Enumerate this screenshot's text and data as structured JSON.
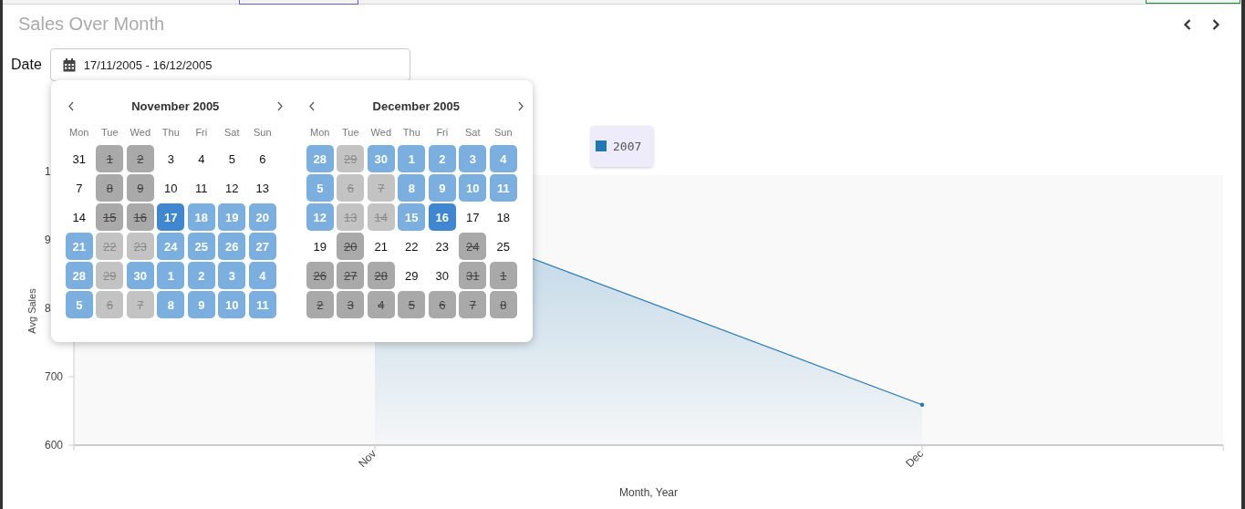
{
  "title": "Sales Over Month",
  "date_filter": {
    "label": "Date",
    "value": "17/11/2005 - 16/12/2005"
  },
  "date_picker": {
    "months": [
      {
        "title": "November 2005",
        "weekdays": [
          "Mon",
          "Tue",
          "Wed",
          "Thu",
          "Fri",
          "Sat",
          "Sun"
        ],
        "weeks": [
          [
            {
              "day": "31",
              "kind": "plain"
            },
            {
              "day": "1",
              "kind": "blocked"
            },
            {
              "day": "2",
              "kind": "blocked"
            },
            {
              "day": "3",
              "kind": "plain"
            },
            {
              "day": "4",
              "kind": "plain"
            },
            {
              "day": "5",
              "kind": "plain"
            },
            {
              "day": "6",
              "kind": "plain"
            }
          ],
          [
            {
              "day": "7",
              "kind": "plain"
            },
            {
              "day": "8",
              "kind": "blocked"
            },
            {
              "day": "9",
              "kind": "blocked"
            },
            {
              "day": "10",
              "kind": "plain"
            },
            {
              "day": "11",
              "kind": "plain"
            },
            {
              "day": "12",
              "kind": "plain"
            },
            {
              "day": "13",
              "kind": "plain"
            }
          ],
          [
            {
              "day": "14",
              "kind": "plain"
            },
            {
              "day": "15",
              "kind": "blocked"
            },
            {
              "day": "16",
              "kind": "blocked"
            },
            {
              "day": "17",
              "kind": "end"
            },
            {
              "day": "18",
              "kind": "range"
            },
            {
              "day": "19",
              "kind": "range"
            },
            {
              "day": "20",
              "kind": "range"
            }
          ],
          [
            {
              "day": "21",
              "kind": "range"
            },
            {
              "day": "22",
              "kind": "blocked_range"
            },
            {
              "day": "23",
              "kind": "blocked_range"
            },
            {
              "day": "24",
              "kind": "range"
            },
            {
              "day": "25",
              "kind": "range"
            },
            {
              "day": "26",
              "kind": "range"
            },
            {
              "day": "27",
              "kind": "range"
            }
          ],
          [
            {
              "day": "28",
              "kind": "range"
            },
            {
              "day": "29",
              "kind": "blocked_range"
            },
            {
              "day": "30",
              "kind": "range"
            },
            {
              "day": "1",
              "kind": "range"
            },
            {
              "day": "2",
              "kind": "range"
            },
            {
              "day": "3",
              "kind": "range"
            },
            {
              "day": "4",
              "kind": "range"
            }
          ],
          [
            {
              "day": "5",
              "kind": "range"
            },
            {
              "day": "6",
              "kind": "blocked_range"
            },
            {
              "day": "7",
              "kind": "blocked_range"
            },
            {
              "day": "8",
              "kind": "range"
            },
            {
              "day": "9",
              "kind": "range"
            },
            {
              "day": "10",
              "kind": "range"
            },
            {
              "day": "11",
              "kind": "range"
            }
          ]
        ]
      },
      {
        "title": "December 2005",
        "weekdays": [
          "Mon",
          "Tue",
          "Wed",
          "Thu",
          "Fri",
          "Sat",
          "Sun"
        ],
        "weeks": [
          [
            {
              "day": "28",
              "kind": "range"
            },
            {
              "day": "29",
              "kind": "blocked_range"
            },
            {
              "day": "30",
              "kind": "range"
            },
            {
              "day": "1",
              "kind": "range"
            },
            {
              "day": "2",
              "kind": "range"
            },
            {
              "day": "3",
              "kind": "range"
            },
            {
              "day": "4",
              "kind": "range"
            }
          ],
          [
            {
              "day": "5",
              "kind": "range"
            },
            {
              "day": "6",
              "kind": "blocked_range"
            },
            {
              "day": "7",
              "kind": "blocked_range"
            },
            {
              "day": "8",
              "kind": "range"
            },
            {
              "day": "9",
              "kind": "range"
            },
            {
              "day": "10",
              "kind": "range"
            },
            {
              "day": "11",
              "kind": "range"
            }
          ],
          [
            {
              "day": "12",
              "kind": "range"
            },
            {
              "day": "13",
              "kind": "blocked_range"
            },
            {
              "day": "14",
              "kind": "blocked_range"
            },
            {
              "day": "15",
              "kind": "range"
            },
            {
              "day": "16",
              "kind": "end"
            },
            {
              "day": "17",
              "kind": "plain"
            },
            {
              "day": "18",
              "kind": "plain"
            }
          ],
          [
            {
              "day": "19",
              "kind": "plain"
            },
            {
              "day": "20",
              "kind": "blocked"
            },
            {
              "day": "21",
              "kind": "plain"
            },
            {
              "day": "22",
              "kind": "plain"
            },
            {
              "day": "23",
              "kind": "plain"
            },
            {
              "day": "24",
              "kind": "blocked"
            },
            {
              "day": "25",
              "kind": "plain"
            }
          ],
          [
            {
              "day": "26",
              "kind": "blocked"
            },
            {
              "day": "27",
              "kind": "blocked"
            },
            {
              "day": "28",
              "kind": "blocked"
            },
            {
              "day": "29",
              "kind": "plain"
            },
            {
              "day": "30",
              "kind": "plain"
            },
            {
              "day": "31",
              "kind": "blocked"
            },
            {
              "day": "1",
              "kind": "blocked"
            }
          ],
          [
            {
              "day": "2",
              "kind": "blocked"
            },
            {
              "day": "3",
              "kind": "blocked"
            },
            {
              "day": "4",
              "kind": "blocked"
            },
            {
              "day": "5",
              "kind": "blocked"
            },
            {
              "day": "6",
              "kind": "blocked"
            },
            {
              "day": "7",
              "kind": "blocked"
            },
            {
              "day": "8",
              "kind": "blocked"
            }
          ]
        ]
      }
    ]
  },
  "chart": {
    "chart_data": {
      "type": "area",
      "xlabel": "Month, Year",
      "ylabel": "Avg Sales",
      "categories": [
        "Nov",
        "Dec"
      ],
      "series": [
        {
          "name": "2007",
          "color": "#1f77b4",
          "values": [
            959,
            659
          ]
        }
      ],
      "ylim": [
        600,
        1000
      ],
      "yticks": [
        600,
        700
      ]
    },
    "cut_tick_labels": [
      "1",
      "9",
      "8"
    ]
  }
}
